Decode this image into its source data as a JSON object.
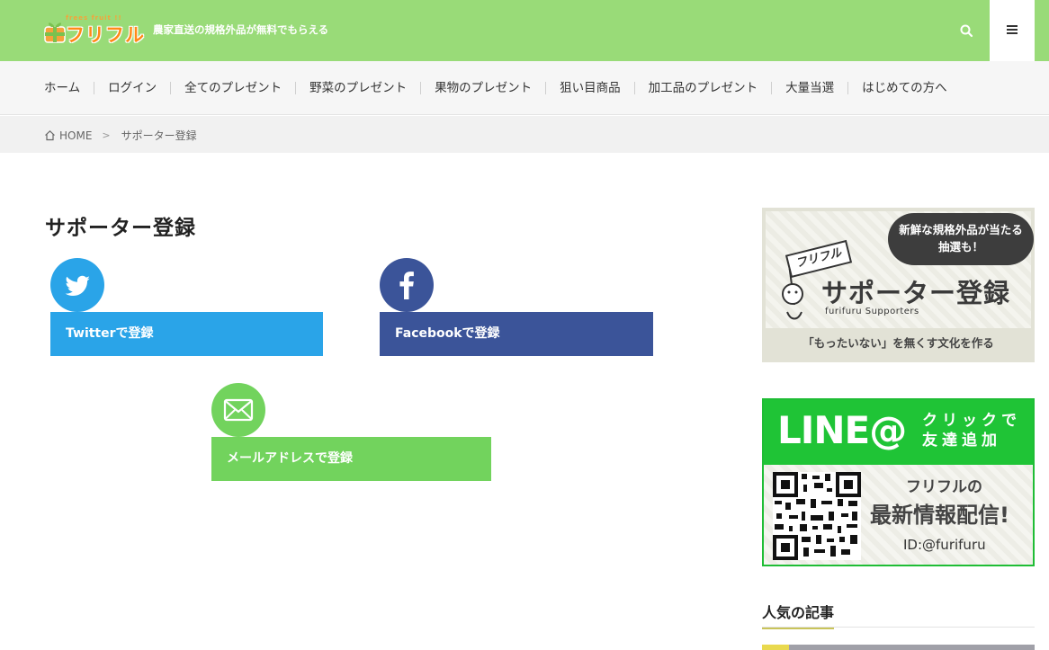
{
  "header": {
    "logo_small": "frees fruit !!",
    "logo_text": "フリフル",
    "tagline": "農家直送の規格外品が無料でもらえる"
  },
  "nav": {
    "items": [
      {
        "label": "ホーム"
      },
      {
        "label": "ログイン"
      },
      {
        "label": "全てのプレゼント"
      },
      {
        "label": "野菜のプレゼント"
      },
      {
        "label": "果物のプレゼント"
      },
      {
        "label": "狙い目商品"
      },
      {
        "label": "加工品のプレゼント"
      },
      {
        "label": "大量当選"
      },
      {
        "label": "はじめての方へ"
      }
    ]
  },
  "breadcrumb": {
    "home": "HOME",
    "current": "サポーター登録"
  },
  "main": {
    "title": "サポーター登録",
    "twitter_label": "Twitterで登録",
    "facebook_label": "Facebookで登録",
    "email_label": "メールアドレスで登録"
  },
  "sidebar": {
    "supporter_banner": {
      "bubble_line1": "新鮮な規格外品が当たる",
      "bubble_line2": "抽選も！",
      "flag": "フリフル",
      "main_text": "サポーター登録",
      "sub_en": "furifuru Supporters",
      "bottom": "「もったいない」を無くす文化を作る"
    },
    "line_banner": {
      "logo": "LINE@",
      "click_line1": "クリックで",
      "click_line2": "友達追加",
      "text1": "フリフルの",
      "text2": "最新情報配信!",
      "id": "ID:@furifuru"
    },
    "popular_heading": "人気の記事"
  },
  "colors": {
    "header_green": "#99db78",
    "twitter_blue": "#2aa4e8",
    "facebook_blue": "#3b5499",
    "mail_green": "#72d35d",
    "line_green": "#1fc436"
  }
}
